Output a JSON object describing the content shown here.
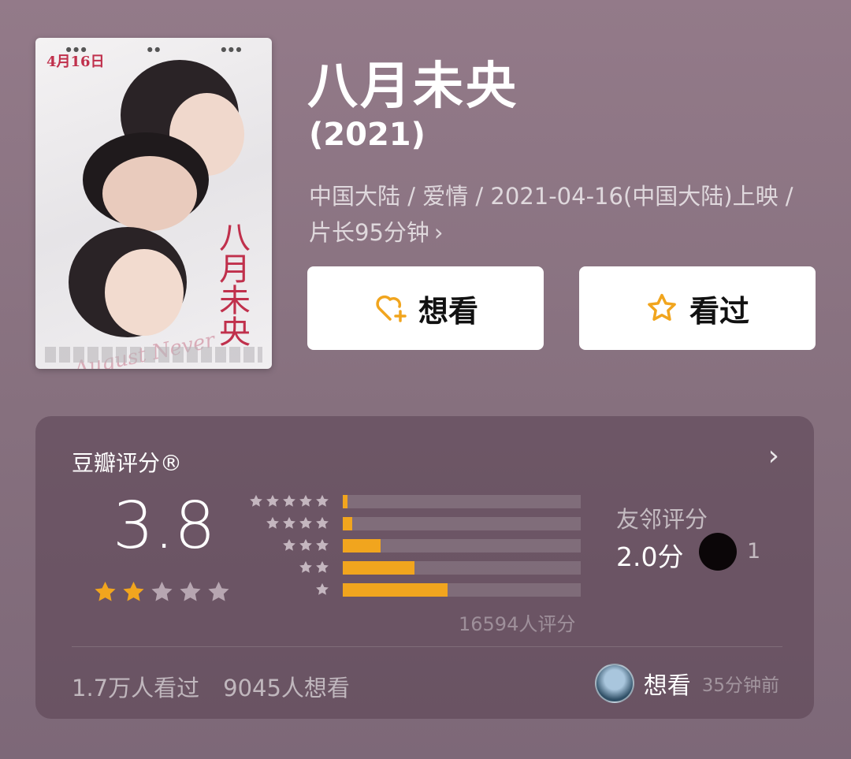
{
  "movie": {
    "title": "八月未央",
    "year": "(2021)",
    "meta": "中国大陆 / 爱情 / 2021-04-16(中国大陆)上映 / 片长95分钟",
    "poster_title": "八月未央",
    "poster_date": "4月16日",
    "poster_script": "August Never ends"
  },
  "actions": {
    "want_label": "想看",
    "want_icon": "heart-plus-icon",
    "seen_label": "看过",
    "seen_icon": "star-outline-icon"
  },
  "rating": {
    "title": "豆瓣评分®",
    "score": "3.8",
    "stars": 2,
    "distribution": [
      {
        "stars": 5,
        "fraction": 0.02
      },
      {
        "stars": 4,
        "fraction": 0.04
      },
      {
        "stars": 3,
        "fraction": 0.16
      },
      {
        "stars": 2,
        "fraction": 0.3
      },
      {
        "stars": 1,
        "fraction": 0.44
      }
    ],
    "raters": "16594人评分",
    "friends_label": "友邻评分",
    "friends_score": "2.0分",
    "friends_count": "1",
    "watched": "1.7万人看过",
    "wish": "9045人想看",
    "recent_action": "想看",
    "recent_time": "35分钟前"
  },
  "colors": {
    "accent": "#f1a51e",
    "star_empty": "#b7a6b1",
    "star_label": "#c4b6bf"
  }
}
